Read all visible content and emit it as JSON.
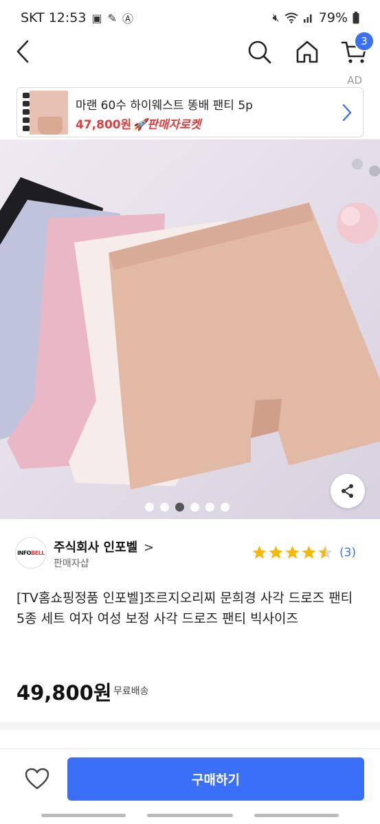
{
  "status_bar": {
    "carrier_time": "SKT 12:53",
    "battery": "79%",
    "icons": [
      "image-icon",
      "assistant-icon",
      "a-circle-icon",
      "mute-icon",
      "wifi-icon",
      "signal-icon",
      "battery-icon"
    ]
  },
  "nav": {
    "icons": [
      "back-icon",
      "search-icon",
      "home-icon",
      "cart-icon"
    ],
    "cart_count": "3"
  },
  "ad": {
    "label": "AD",
    "title": "마랜 60수 하이웨스트 똥배 팬티 5p",
    "price": "47,800원",
    "rocket_label": "🚀판매자로켓"
  },
  "image_carousel": {
    "page_count": 6,
    "active_index": 1
  },
  "seller": {
    "logo_text_a": "INFO",
    "logo_text_b": "BELL",
    "name": "주식회사 인포벨",
    "chevron": ">",
    "type": "판매자샵"
  },
  "rating": {
    "stars": 4.5,
    "count": "(3)",
    "star_color": "#f5b800"
  },
  "product": {
    "title": "[TV홈쇼핑정품 인포벨]조르지오리찌 문희경 사각 드로즈 팬티 5종 세트 여자 여성 보정 사각 드로즈 팬티 빅사이즈",
    "price": "49,800원",
    "shipping": "무료배송"
  },
  "bottom_bar": {
    "buy_label": "구매하기",
    "accent": "#3b6ff5"
  }
}
